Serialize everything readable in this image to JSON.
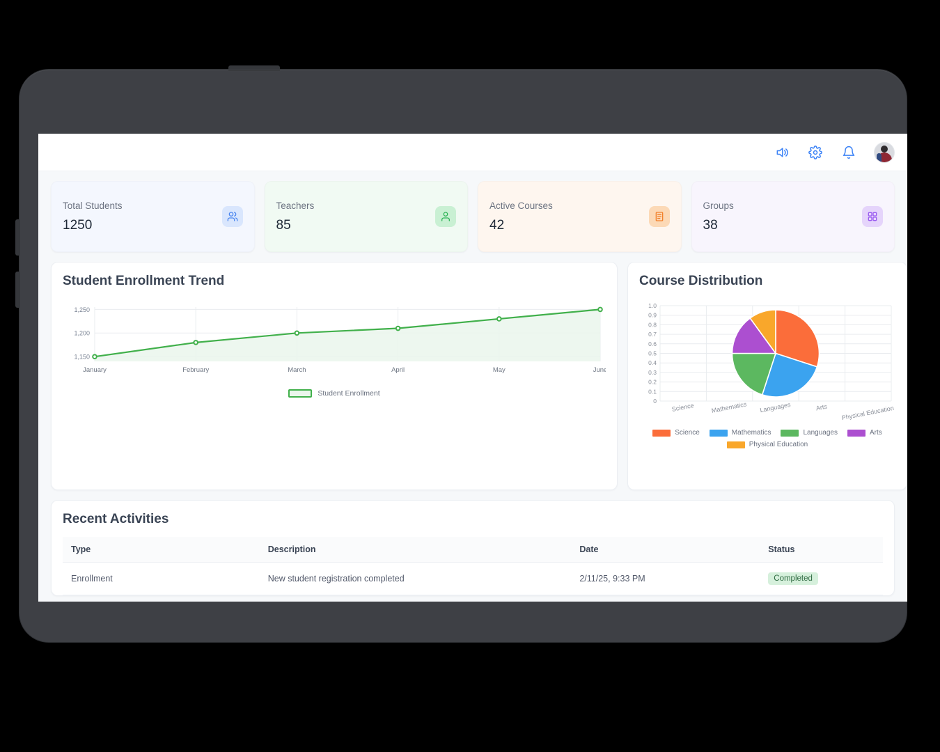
{
  "header": {
    "icons": [
      {
        "name": "volume-icon",
        "label": "Announcements"
      },
      {
        "name": "gear-icon",
        "label": "Settings"
      },
      {
        "name": "bell-icon",
        "label": "Notifications"
      }
    ],
    "avatar_alt": "User profile"
  },
  "stats": [
    {
      "label": "Total Students",
      "value": "1250",
      "icon": "users-icon",
      "theme": "sc-blue"
    },
    {
      "label": "Teachers",
      "value": "85",
      "icon": "user-icon",
      "theme": "sc-green"
    },
    {
      "label": "Active Courses",
      "value": "42",
      "icon": "book-icon",
      "theme": "sc-orange"
    },
    {
      "label": "Groups",
      "value": "38",
      "icon": "grid-icon",
      "theme": "sc-purple"
    }
  ],
  "line_panel": {
    "title": "Student Enrollment Trend"
  },
  "pie_panel": {
    "title": "Course Distribution"
  },
  "activities": {
    "title": "Recent Activities",
    "columns": [
      "Type",
      "Description",
      "Date",
      "Status"
    ],
    "rows": [
      {
        "type": "Enrollment",
        "description": "New student registration completed",
        "date": "2/11/25, 9:33 PM",
        "status": "Completed"
      }
    ]
  },
  "chart_data": [
    {
      "type": "area",
      "title": "Student Enrollment Trend",
      "categories": [
        "January",
        "February",
        "March",
        "April",
        "May",
        "June"
      ],
      "series": [
        {
          "name": "Student Enrollment",
          "values": [
            1150,
            1180,
            1200,
            1210,
            1230,
            1250
          ],
          "color": "#41b04b",
          "fill": "#eaf6ec"
        }
      ],
      "ylabel": "",
      "xlabel": "",
      "yticks": [
        1150,
        1200,
        1250
      ],
      "ytick_labels": [
        "1,150",
        "1,200",
        "1,250"
      ],
      "ylim": [
        1140,
        1255
      ],
      "grid": true,
      "legend": "bottom-center"
    },
    {
      "type": "pie",
      "title": "Course Distribution",
      "categories": [
        "Science",
        "Mathematics",
        "Languages",
        "Arts",
        "Physical Education"
      ],
      "values": [
        30,
        25,
        20,
        15,
        10
      ],
      "colors": [
        "#fb6d3a",
        "#3ba3ef",
        "#5cb860",
        "#ac4fd0",
        "#f9a72b"
      ],
      "yticks": [
        0,
        0.1,
        0.2,
        0.3,
        0.4,
        0.5,
        0.6,
        0.7,
        0.8,
        0.9,
        1.0
      ],
      "ytick_labels": [
        "0",
        "0.1",
        "0.2",
        "0.3",
        "0.4",
        "0.5",
        "0.6",
        "0.7",
        "0.8",
        "0.9",
        "1.0"
      ],
      "ylim": [
        0,
        1.0
      ],
      "grid": true,
      "legend": "bottom-center"
    }
  ]
}
